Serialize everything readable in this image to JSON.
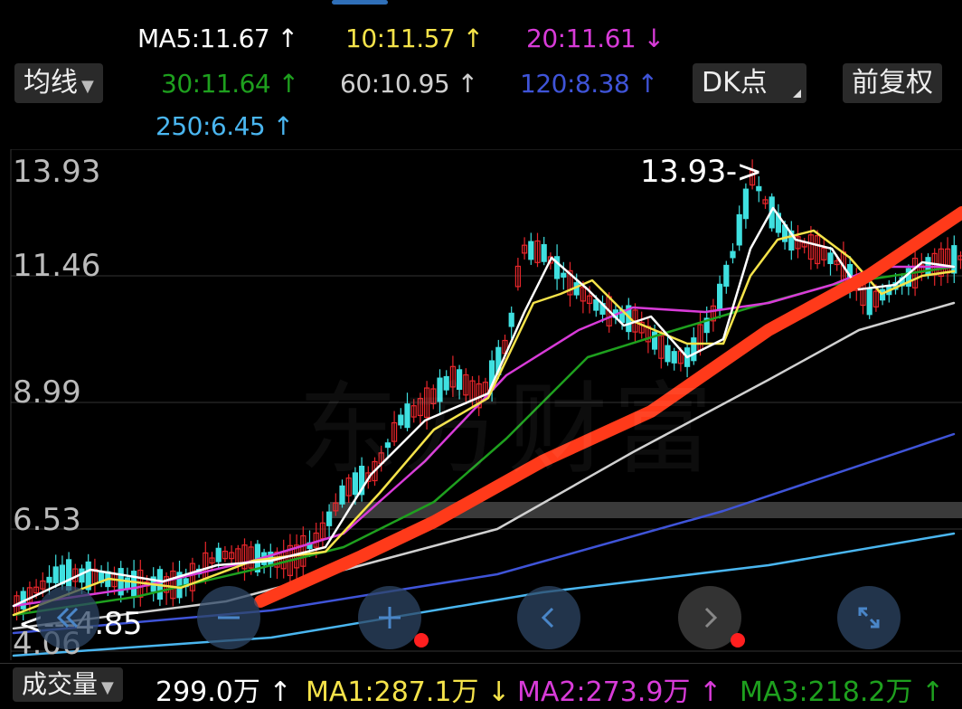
{
  "ma_lines": {
    "ma5": {
      "text": "MA5:11.67 ↑",
      "color": "#ffffff"
    },
    "ma10": {
      "text": "10:11.57 ↑",
      "color": "#f5e34a"
    },
    "ma20": {
      "text": "20:11.61 ↓",
      "color": "#d83bd8"
    },
    "ma30": {
      "text": "30:11.64 ↑",
      "color": "#1ea01e"
    },
    "ma60": {
      "text": "60:10.95 ↑",
      "color": "#d0d0d0"
    },
    "ma120": {
      "text": "120:8.38 ↑",
      "color": "#3f54d8"
    },
    "ma250": {
      "text": "250:6.45 ↑",
      "color": "#4ab6f0"
    }
  },
  "controls": {
    "indicator_select": "均线",
    "dk_button": "DK点",
    "adjust_button": "前复权"
  },
  "price_axis": [
    "13.93",
    "11.46",
    "8.99",
    "6.53",
    "4.06"
  ],
  "annotations": {
    "high": "13.93->",
    "low": "<---4.85"
  },
  "watermark": "东方财富",
  "volume": {
    "select": "成交量",
    "value": "299.0万 ↑",
    "ma1": "MA1:287.1万 ↓",
    "ma2": "MA2:273.9万 ↑",
    "ma3": "MA3:218.2万 ↑"
  },
  "colors": {
    "up": "#e8262b",
    "down": "#3fe0e0",
    "dk_line": "#ff3a1a"
  }
}
